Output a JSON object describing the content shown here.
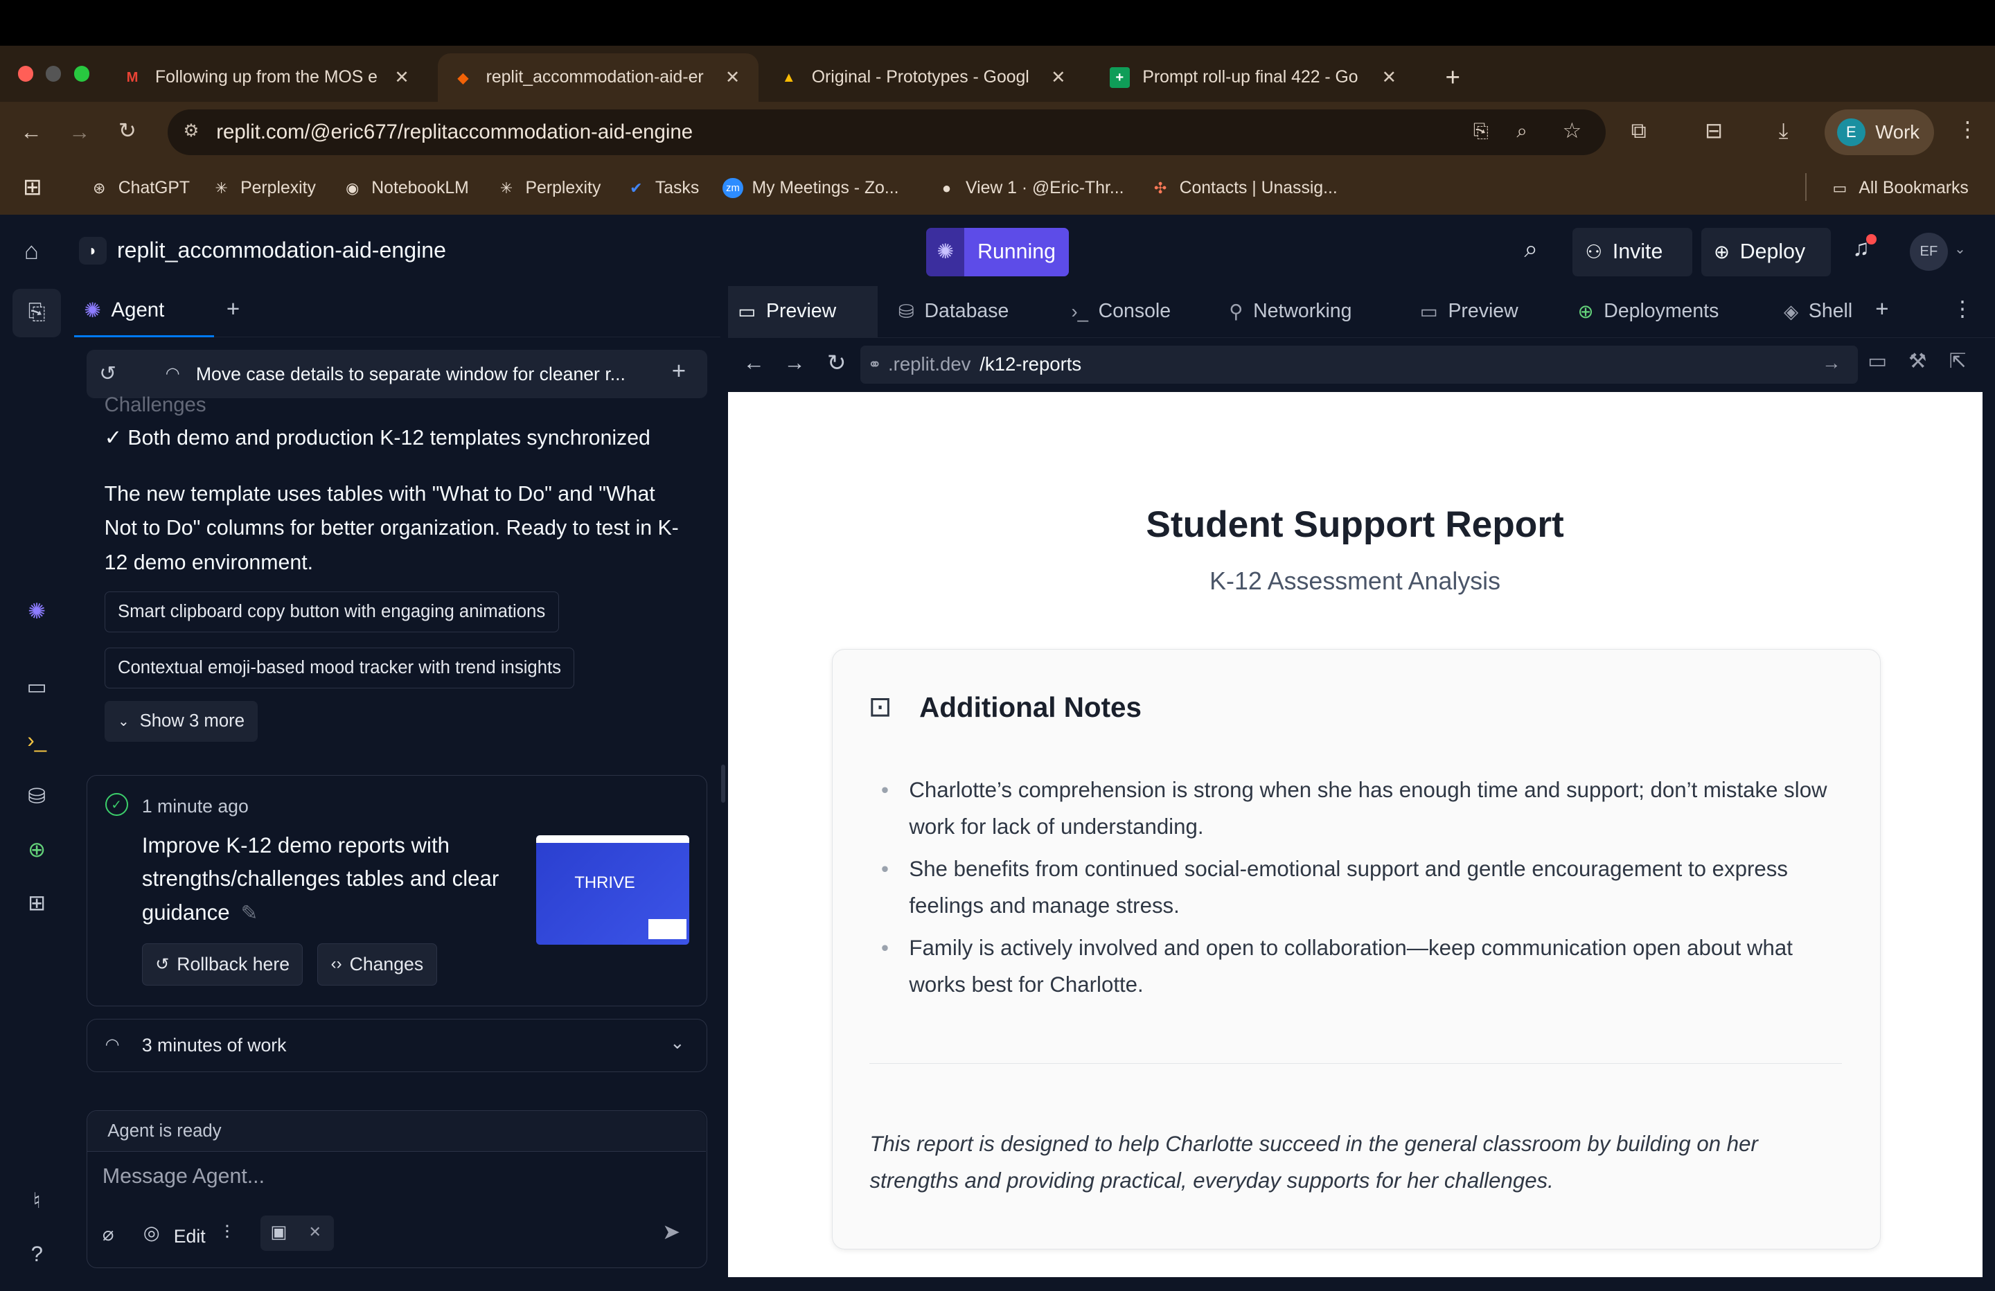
{
  "browser": {
    "tabs": [
      {
        "title": "Following up from the MOS e",
        "favicon": "M",
        "color": "#ea4335"
      },
      {
        "title": "replit_accommodation-aid-er",
        "favicon": "R",
        "color": "#f26207"
      },
      {
        "title": "Original - Prototypes - Googl",
        "favicon": "▲",
        "color": "#34a853"
      },
      {
        "title": "Prompt roll-up final 422 - Go",
        "favicon": "+",
        "color": "#0f9d58"
      }
    ],
    "new_tab": "+",
    "url": "replit.com/@eric677/replitaccommodation-aid-engine",
    "profile_label": "Work",
    "profile_initial": "E",
    "bookmarks": [
      "ChatGPT",
      "Perplexity",
      "NotebookLM",
      "Perplexity",
      "Tasks",
      "My Meetings - Zo...",
      "View 1 · @Eric-Thr...",
      "Contacts | Unassig..."
    ],
    "all_bookmarks": "All Bookmarks"
  },
  "replit": {
    "project_name": "replit_accommodation-aid-engine",
    "run_status": "Running",
    "invite": "Invite",
    "deploy": "Deploy",
    "avatar": "EF"
  },
  "agent": {
    "tab_label": "Agent",
    "add": "+",
    "thread_title": "Move case details to separate window for cleaner r...",
    "cut_line": "Challenges",
    "check_line": "✓ Both demo and production K-12 templates synchronized",
    "message": "The new template uses tables with \"What to Do\" and \"What Not to Do\" columns for better organization. Ready to test in K-12 demo environment.",
    "suggestions": [
      "Smart clipboard copy button with engaging animations",
      "Contextual emoji-based mood tracker with trend insights"
    ],
    "show_more": "Show 3 more",
    "checkpoint": {
      "time": "1 minute ago",
      "title": "Improve K-12 demo reports with strengths/challenges tables and clear guidance",
      "thumb_text": "THRIVE",
      "rollback": "Rollback here",
      "changes": "Changes"
    },
    "work_summary": "3 minutes of work",
    "status": "Agent is ready",
    "input_placeholder": "Message Agent...",
    "edit_label": "Edit"
  },
  "workspace_tabs": [
    "Preview",
    "Database",
    "Console",
    "Networking",
    "Preview",
    "Deployments",
    "Shell"
  ],
  "preview": {
    "url_prefix": ".replit.dev",
    "url_path": "/k12-reports",
    "report_title": "Student Support Report",
    "report_subtitle": "K-12 Assessment Analysis",
    "notes_heading": "Additional Notes",
    "notes": [
      "Charlotte’s comprehension is strong when she has enough time and support; don’t mistake slow work for lack of understanding.",
      "She benefits from continued social-emotional support and gentle encouragement to express feelings and manage stress.",
      "Family is actively involved and open to collaboration—keep communication open about what works best for Charlotte."
    ],
    "closing": "This report is designed to help Charlotte succeed in the general classroom by building on her strengths and providing practical, everyday supports for her challenges."
  },
  "colors": {
    "replit_bg": "#0e1525",
    "running": "#5d4ce8",
    "chrome_bg": "#3a2a1a"
  }
}
